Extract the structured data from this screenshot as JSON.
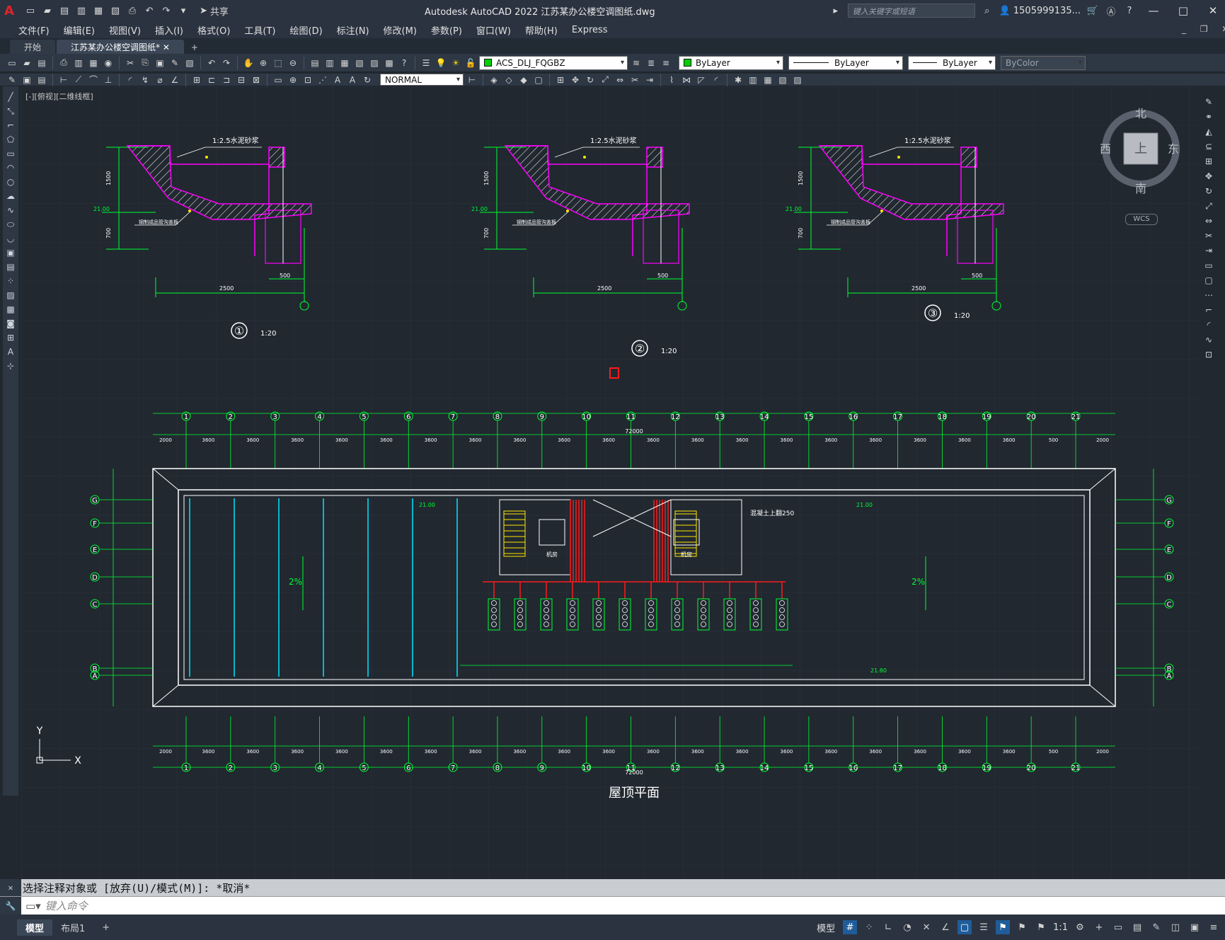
{
  "app": {
    "title": "Autodesk AutoCAD 2022    江苏某办公楼空调图纸.dwg",
    "share_label": "共享",
    "search_placeholder": "键入关键字或短语",
    "user": "1505999135...",
    "logo": "A"
  },
  "menu": [
    "文件(F)",
    "编辑(E)",
    "视图(V)",
    "插入(I)",
    "格式(O)",
    "工具(T)",
    "绘图(D)",
    "标注(N)",
    "修改(M)",
    "参数(P)",
    "窗口(W)",
    "帮助(H)",
    "Express"
  ],
  "tabs": [
    "开始",
    "江苏某办公楼空调图纸*"
  ],
  "toolbar": {
    "layer": "ACS_DLJ_FQGBZ",
    "color": "ByLayer",
    "linetype": "ByLayer",
    "lineweight": "ByLayer",
    "plotstyle": "ByColor",
    "dimstyle": "NORMAL"
  },
  "viewport_label": "[-][俯视][二维线框]",
  "viewcube": {
    "north": "北",
    "south": "南",
    "east": "东",
    "west": "西",
    "top": "上",
    "ucs": "WCS"
  },
  "drawing": {
    "details": [
      {
        "num": "①",
        "scale": "1:20",
        "note1": "1:2.5水泥砂浆",
        "note2": "钢制成品管沟盖板",
        "dim_top": "1500",
        "dim_bot": "700",
        "dim_width": "2500",
        "dim_small": "500",
        "elev": "21.00"
      },
      {
        "num": "②",
        "scale": "1:20",
        "note1": "1:2.5水泥砂浆",
        "note2": "钢制成品管沟盖板",
        "dim_top": "1500",
        "dim_bot": "700",
        "dim_width": "2500",
        "dim_small": "500",
        "elev": "21.00"
      },
      {
        "num": "③",
        "scale": "1:20",
        "note1": "1:2.5水泥砂浆",
        "note2": "钢制成品管沟盖板",
        "dim_top": "1500",
        "dim_bot": "700",
        "dim_width": "2500",
        "dim_small": "500",
        "elev": "21.00"
      }
    ],
    "grid_cols": [
      "1",
      "2",
      "3",
      "4",
      "5",
      "6",
      "7",
      "8",
      "9",
      "10",
      "11",
      "12",
      "13",
      "14",
      "15",
      "16",
      "17",
      "18",
      "19",
      "20",
      "21"
    ],
    "grid_rows": [
      "G",
      "F",
      "E",
      "D",
      "C",
      "B",
      "A"
    ],
    "total_width": "72000",
    "bay_spacings": [
      "2000",
      "500",
      "3600",
      "3600",
      "3600",
      "3600",
      "3600",
      "3600",
      "3600",
      "3600",
      "3600",
      "3600",
      "3600",
      "3600",
      "3600",
      "3600",
      "3600",
      "3600",
      "3600",
      "3600",
      "3600",
      "500",
      "2000"
    ],
    "slope_left": "2%",
    "slope_right": "2%",
    "elev_left": "21.00",
    "elev_right": "21.00",
    "elev_bottom": "21.80",
    "equipment_label": "机房",
    "roof_note": "混凝土上翻250",
    "plan_title": "屋顶平面"
  },
  "ucs_icon": {
    "x": "X",
    "y": "Y"
  },
  "command": {
    "history": "选择注释对象或 [放弃(U)/模式(M)]: *取消*",
    "placeholder": "键入命令"
  },
  "layouts": [
    "模型",
    "布局1"
  ],
  "status": {
    "model": "模型",
    "scale": "1:1"
  }
}
